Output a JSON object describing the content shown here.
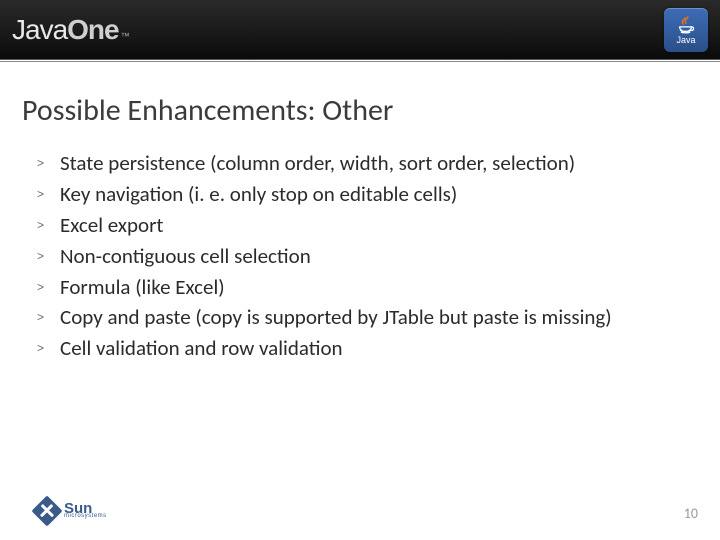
{
  "header": {
    "logo_java": "Java",
    "logo_one": "One",
    "logo_tm": "™",
    "java_badge_label": "Java"
  },
  "title": "Possible Enhancements: Other",
  "bullets": [
    "State persistence (column order, width, sort order, selection)",
    "Key navigation (i. e. only stop on editable cells)",
    "Excel export",
    "Non-contiguous cell selection",
    "Formula (like Excel)",
    "Copy and paste (copy is supported by JTable but paste is missing)",
    "Cell validation and row validation"
  ],
  "footer": {
    "sun_label": "Sun",
    "sun_sub": "microsystems",
    "page_number": "10"
  }
}
